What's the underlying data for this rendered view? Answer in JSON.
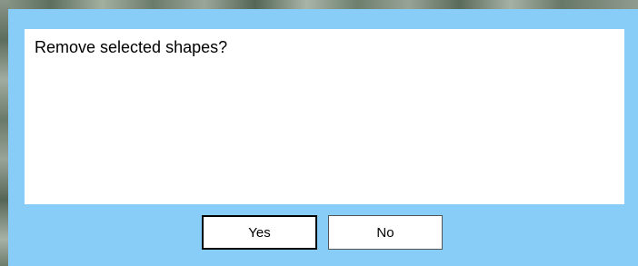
{
  "dialog": {
    "message": "Remove selected shapes?",
    "yes_label": "Yes",
    "no_label": "No",
    "background_color": "#87cdf7",
    "panel_color": "#ffffff"
  }
}
